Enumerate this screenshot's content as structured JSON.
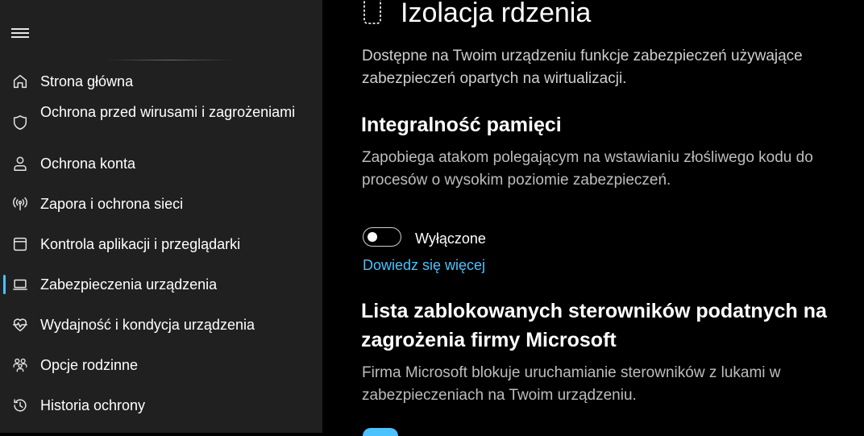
{
  "sidebar": {
    "items": [
      {
        "label": "Strona główna",
        "icon": "home-icon"
      },
      {
        "label": "Ochrona przed wirusami i zagrożeniami",
        "icon": "shield-icon"
      },
      {
        "label": "Ochrona konta",
        "icon": "person-icon"
      },
      {
        "label": "Zapora i ochrona sieci",
        "icon": "wireless-icon"
      },
      {
        "label": "Kontrola aplikacji i przeglądarki",
        "icon": "app-window-icon"
      },
      {
        "label": "Zabezpieczenia urządzenia",
        "icon": "laptop-icon"
      },
      {
        "label": "Wydajność i kondycja urządzenia",
        "icon": "heart-pulse-icon"
      },
      {
        "label": "Opcje rodzinne",
        "icon": "family-icon"
      },
      {
        "label": "Historia ochrony",
        "icon": "history-icon"
      }
    ],
    "active_index": 5
  },
  "main": {
    "title": "Izolacja rdzenia",
    "description": "Dostępne na Twoim urządzeniu funkcje zabezpieczeń używające zabezpieczeń opartych na wirtualizacji.",
    "memory_integrity": {
      "heading": "Integralność pamięci",
      "description": "Zapobiega atakom polegającym na wstawianiu złośliwego kodu do procesów o wysokim poziomie zabezpieczeń.",
      "toggle_state": "Wyłączone",
      "toggle_on": false,
      "learn_more": "Dowiedz się więcej"
    },
    "blocklist": {
      "heading": "Lista zablokowanych sterowników podatnych na zagrożenia firmy Microsoft",
      "description": "Firma Microsoft blokuje uruchamianie sterowników z lukami w zabezpieczeniach na Twoim urządzeniu."
    }
  },
  "colors": {
    "sidebar_bg": "#202020",
    "main_bg": "#000000",
    "accent": "#4cc2ff"
  }
}
